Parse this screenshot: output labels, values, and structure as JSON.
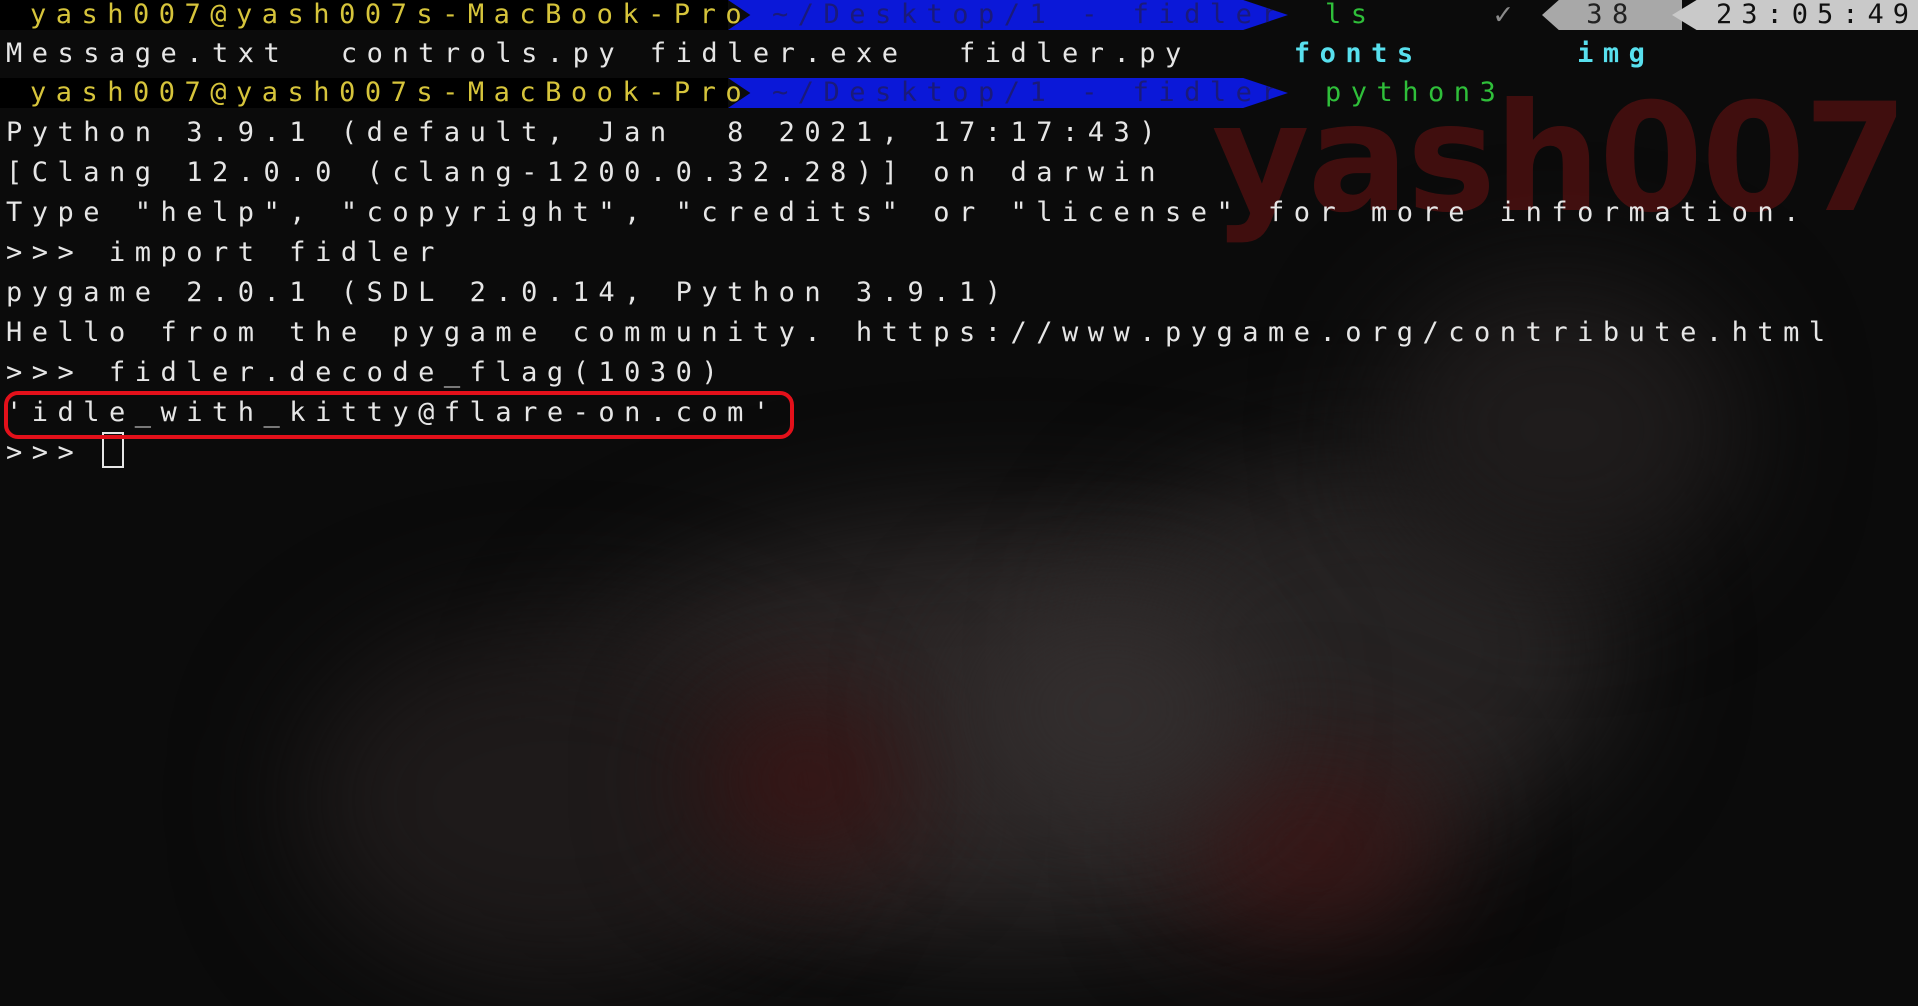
{
  "watermark": "yash007",
  "prompt1": {
    "user_host": "yash007@yash007s-MacBook-Pro",
    "dir": "~/Desktop/1 - fidler",
    "command": "ls",
    "status_icon": "check-icon",
    "status_glyph": "✓",
    "jobs": "38",
    "time": "23:05:49"
  },
  "ls_output": {
    "files": [
      "Message.txt",
      "controls.py",
      "fidler.exe",
      "fidler.py"
    ],
    "dirs": [
      "fonts",
      "img"
    ]
  },
  "prompt2": {
    "user_host": "yash007@yash007s-MacBook-Pro",
    "dir": "~/Desktop/1 - fidler",
    "command": "python3"
  },
  "python_output": [
    "Python 3.9.1 (default, Jan  8 2021, 17:17:43)",
    "[Clang 12.0.0 (clang-1200.0.32.28)] on darwin",
    "Type \"help\", \"copyright\", \"credits\" or \"license\" for more information.",
    ">>> import fidler",
    "pygame 2.0.1 (SDL 2.0.14, Python 3.9.1)",
    "Hello from the pygame community. https://www.pygame.org/contribute.html",
    ">>> fidler.decode_flag(1030)",
    "'idle_with_kitty@flare-on.com'"
  ],
  "repl_prompt": ">>> ",
  "colors": {
    "prompt_user": "#d6c43b",
    "prompt_dir_bg": "#0b18d8",
    "command": "#2fbf3a",
    "dir_listing": "#58e0ee",
    "highlight": "#e3101a",
    "watermark": "#6e1212"
  }
}
